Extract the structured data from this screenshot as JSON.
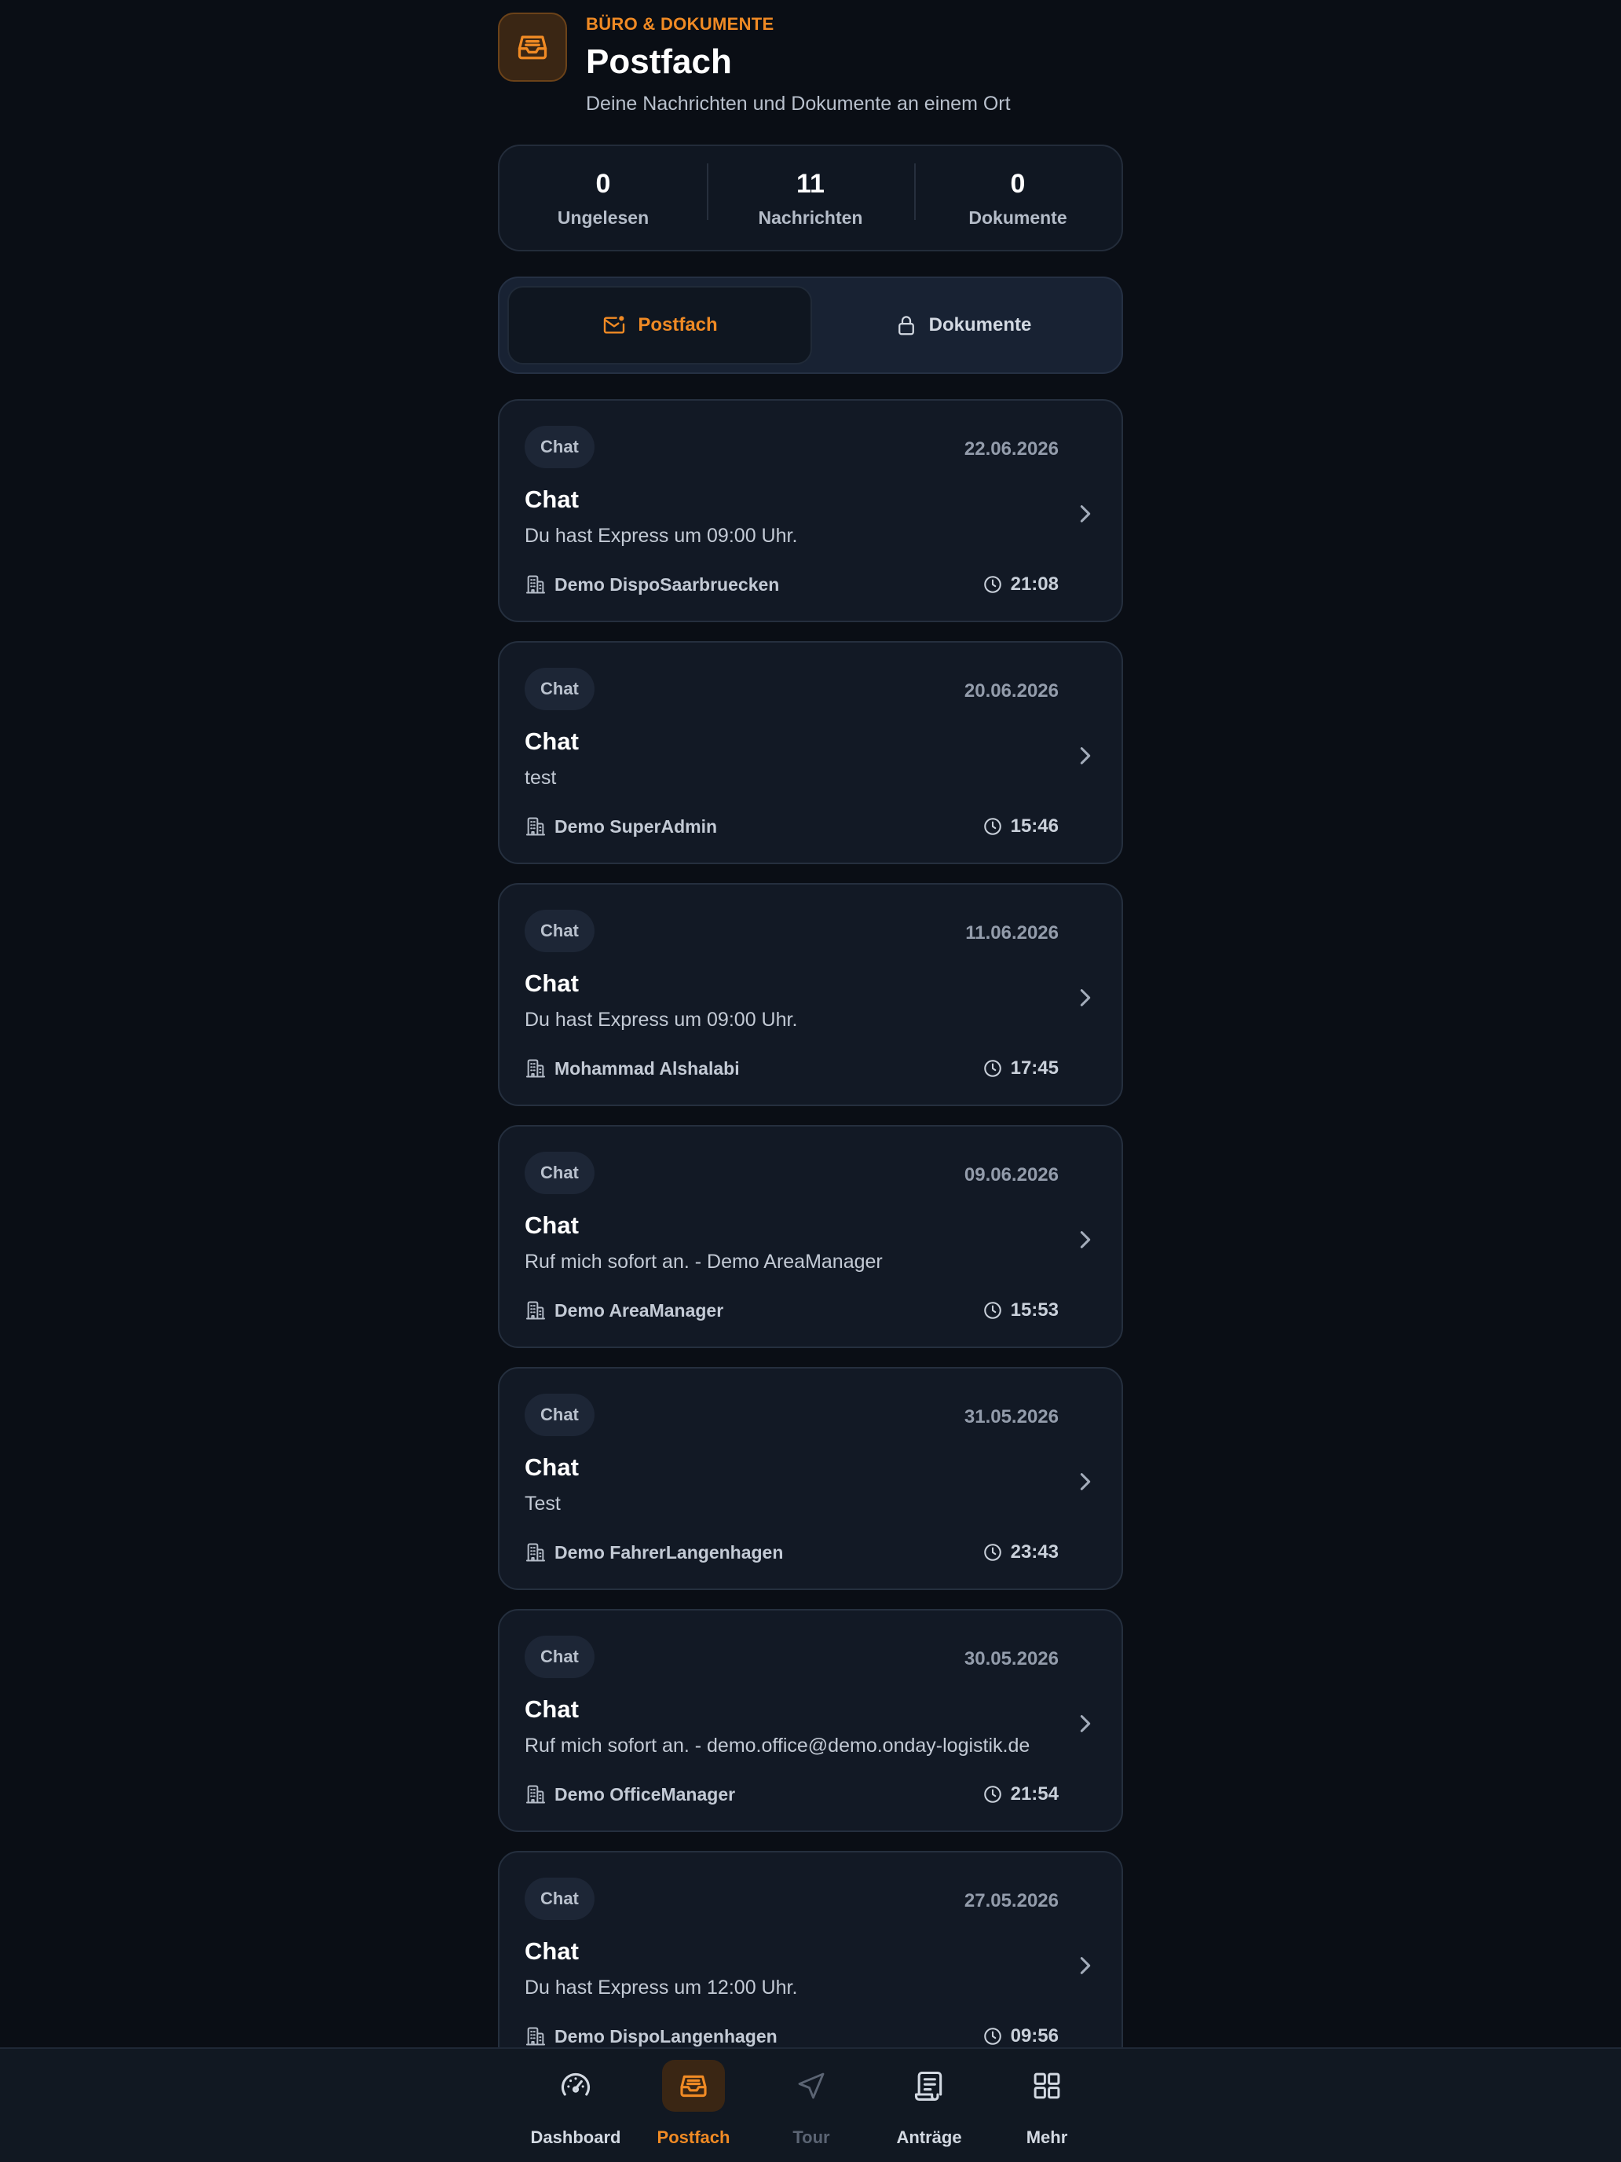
{
  "header": {
    "icon": "inbox-icon",
    "eyebrow": "BÜRO & DOKUMENTE",
    "title": "Postfach",
    "subtitle": "Deine Nachrichten und Dokumente an einem Ort"
  },
  "stats": [
    {
      "value": "0",
      "label": "Ungelesen"
    },
    {
      "value": "11",
      "label": "Nachrichten"
    },
    {
      "value": "0",
      "label": "Dokumente"
    }
  ],
  "tabs": [
    {
      "label": "Postfach",
      "icon": "mail-icon",
      "active": true
    },
    {
      "label": "Dokumente",
      "icon": "lock-icon",
      "active": false
    }
  ],
  "messages": [
    {
      "chip": "Chat",
      "date": "22.06.2026",
      "title": "Chat",
      "text": "Du hast Express um 09:00 Uhr.",
      "sender": "Demo DispoSaarbruecken",
      "time": "21:08"
    },
    {
      "chip": "Chat",
      "date": "20.06.2026",
      "title": "Chat",
      "text": "test",
      "sender": "Demo SuperAdmin",
      "time": "15:46"
    },
    {
      "chip": "Chat",
      "date": "11.06.2026",
      "title": "Chat",
      "text": "Du hast Express um 09:00 Uhr.",
      "sender": "Mohammad Alshalabi",
      "time": "17:45"
    },
    {
      "chip": "Chat",
      "date": "09.06.2026",
      "title": "Chat",
      "text": "Ruf mich sofort an. - Demo AreaManager",
      "sender": "Demo AreaManager",
      "time": "15:53"
    },
    {
      "chip": "Chat",
      "date": "31.05.2026",
      "title": "Chat",
      "text": "Test",
      "sender": "Demo FahrerLangenhagen",
      "time": "23:43"
    },
    {
      "chip": "Chat",
      "date": "30.05.2026",
      "title": "Chat",
      "text": "Ruf mich sofort an. - demo.office@demo.onday-logistik.de",
      "sender": "Demo OfficeManager",
      "time": "21:54"
    },
    {
      "chip": "Chat",
      "date": "27.05.2026",
      "title": "Chat",
      "text": "Du hast Express um 12:00 Uhr.",
      "sender": "Demo DispoLangenhagen",
      "time": "09:56"
    }
  ],
  "nav": [
    {
      "label": "Dashboard",
      "icon": "speedometer-icon",
      "state": "normal"
    },
    {
      "label": "Postfach",
      "icon": "inbox-icon",
      "state": "active"
    },
    {
      "label": "Tour",
      "icon": "navigation-icon",
      "state": "disabled"
    },
    {
      "label": "Anträge",
      "icon": "document-icon",
      "state": "normal"
    },
    {
      "label": "Mehr",
      "icon": "grid-icon",
      "state": "normal"
    }
  ],
  "colors": {
    "accent": "#f08a24",
    "background": "#0a0e15",
    "card": "#121925"
  }
}
